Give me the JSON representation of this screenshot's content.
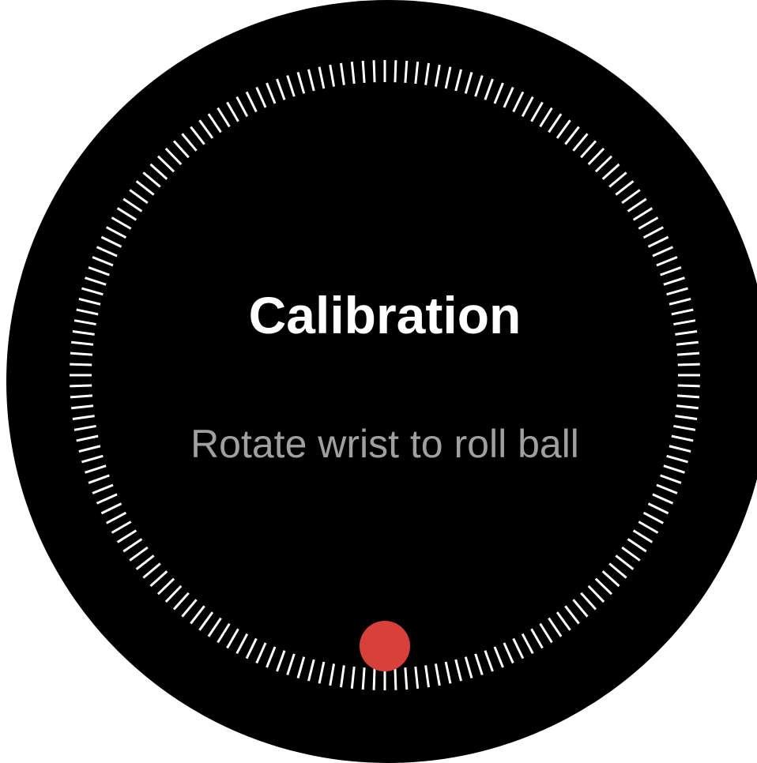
{
  "calibration": {
    "title": "Calibration",
    "instruction": "Rotate wrist to roll ball"
  },
  "colors": {
    "face_background": "#000000",
    "tick_color": "#ffffff",
    "title_color": "#ffffff",
    "instruction_color": "#a0a0a0",
    "ball_color": "#d8403a"
  },
  "ball_position": "bottom",
  "tick_count": 180
}
